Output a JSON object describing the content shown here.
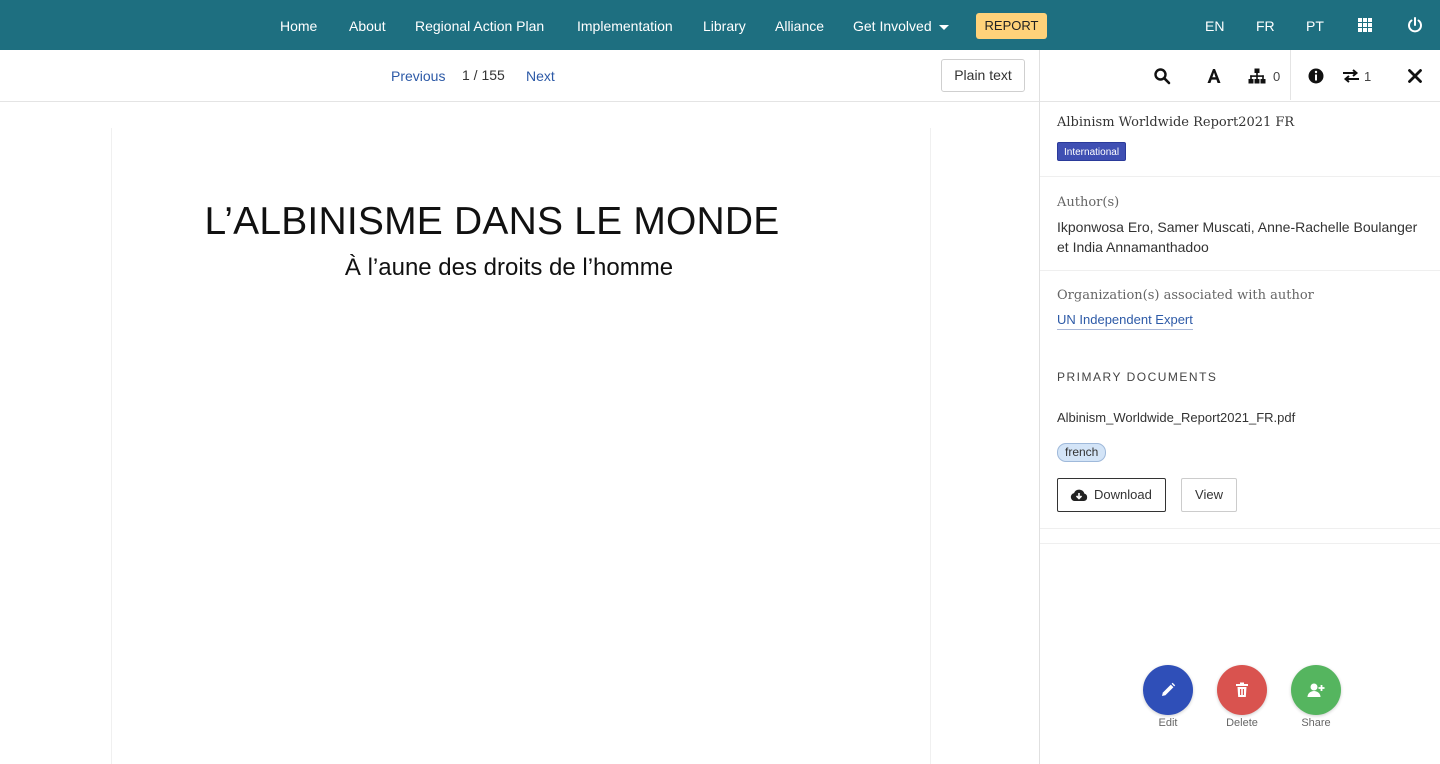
{
  "nav": {
    "items": [
      "Home",
      "About",
      "Regional Action Plan",
      "Implementation",
      "Library",
      "Alliance"
    ],
    "get_involved": "Get Involved",
    "report": "REPORT",
    "languages": [
      "EN",
      "FR",
      "PT"
    ],
    "icons": [
      "grid-icon",
      "power-icon"
    ]
  },
  "pager": {
    "previous": "Previous",
    "count": "1 / 155",
    "next": "Next",
    "plain_text": "Plain text"
  },
  "document": {
    "title": "L’ALBINISME DANS LE MONDE",
    "subtitle": "À l’aune des droits de l’homme"
  },
  "panel": {
    "toolbar": {
      "icons": [
        "search-icon",
        "font-icon",
        "hierarchy-icon",
        "info-icon",
        "exchange-icon",
        "close-icon"
      ],
      "hierarchy_count": "0",
      "exchange_count": "1"
    },
    "doc_name": "Albinism Worldwide Report2021 FR",
    "badge": "International",
    "authors_label": "Author(s)",
    "authors_value": "Ikponwosa Ero, Samer Muscati, Anne-Rachelle Boulanger et India Annamanthadoo",
    "org_label": "Organization(s) associated with author",
    "org_value": "UN Independent Expert",
    "primary_heading": "PRIMARY DOCUMENTS",
    "pdf_name": "Albinism_Worldwide_Report2021_FR.pdf",
    "language": "french",
    "download": "Download",
    "view": "View",
    "actions": {
      "edit": "Edit",
      "delete": "Delete",
      "share": "Share"
    }
  },
  "colors": {
    "nav_bg": "#1e6f80",
    "report_bg": "#ffd27a",
    "edit": "#2f4fb8",
    "delete": "#d9534f",
    "share": "#55b55f",
    "link": "#2d5aa7"
  }
}
